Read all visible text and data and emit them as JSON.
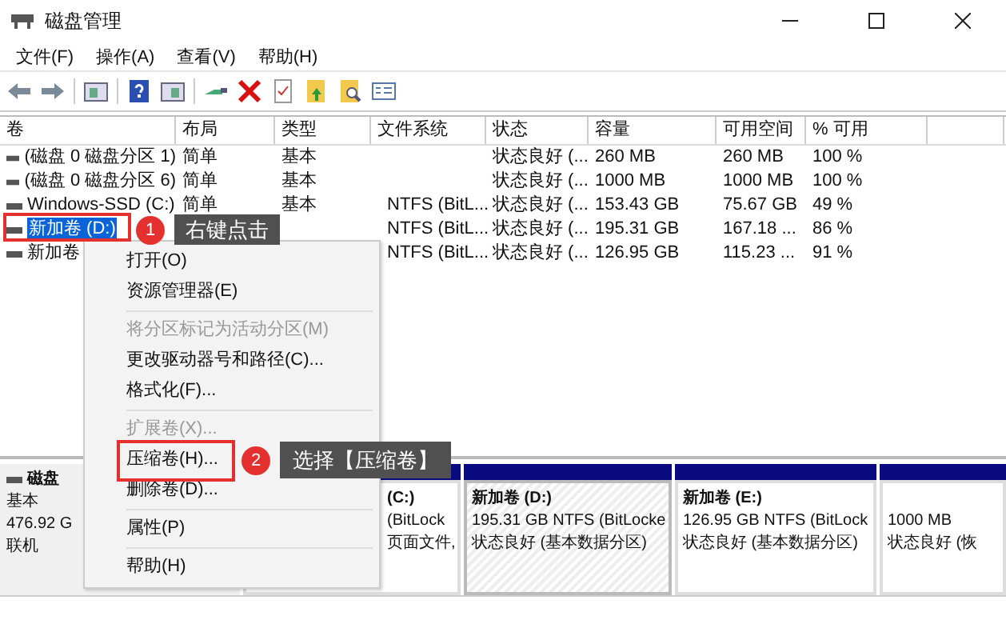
{
  "window": {
    "title": "磁盘管理"
  },
  "menu": [
    "文件(F)",
    "操作(A)",
    "查看(V)",
    "帮助(H)"
  ],
  "table": {
    "columns": [
      "卷",
      "布局",
      "类型",
      "文件系统",
      "状态",
      "容量",
      "可用空间",
      "% 可用"
    ],
    "rows": [
      {
        "cells": [
          "(磁盘 0 磁盘分区 1)",
          "简单",
          "基本",
          "",
          "状态良好 (...",
          "260 MB",
          "260 MB",
          "100 %"
        ],
        "selected": false
      },
      {
        "cells": [
          "(磁盘 0 磁盘分区 6)",
          "简单",
          "基本",
          "",
          "状态良好 (...",
          "1000 MB",
          "1000 MB",
          "100 %"
        ],
        "selected": false
      },
      {
        "cells": [
          "Windows-SSD (C:)",
          "简单",
          "基本",
          "NTFS (BitL...",
          "状态良好 (...",
          "153.43 GB",
          "75.67 GB",
          "49 %"
        ],
        "selected": false
      },
      {
        "cells": [
          "新加卷 (D:)",
          "",
          "",
          "NTFS (BitL...",
          "状态良好 (...",
          "195.31 GB",
          "167.18 ...",
          "86 %"
        ],
        "selected": true
      },
      {
        "cells": [
          "新加卷",
          "",
          "",
          "NTFS (BitL...",
          "状态良好 (...",
          "126.95 GB",
          "115.23 ...",
          "91 %"
        ],
        "selected": false
      }
    ]
  },
  "disk": {
    "lines": [
      "磁盘",
      "基本",
      "476.92 G",
      "联机"
    ],
    "partitions": [
      {
        "lines": [
          "(C:)",
          "(BitLock",
          "页面文件,"
        ],
        "selected": false
      },
      {
        "lines": [
          "新加卷 (D:)",
          "195.31 GB NTFS (BitLocke",
          "状态良好 (基本数据分区)"
        ],
        "selected": true
      },
      {
        "lines": [
          "新加卷 (E:)",
          "126.95 GB NTFS (BitLock",
          "状态良好 (基本数据分区)"
        ],
        "selected": false
      },
      {
        "lines": [
          "1000 MB",
          "状态良好 (恢"
        ],
        "selected": false
      }
    ]
  },
  "context_menu": [
    {
      "kind": "item",
      "label": "打开(O)",
      "disabled": false
    },
    {
      "kind": "item",
      "label": "资源管理器(E)",
      "disabled": false
    },
    {
      "kind": "separator"
    },
    {
      "kind": "item",
      "label": "将分区标记为活动分区(M)",
      "disabled": true
    },
    {
      "kind": "item",
      "label": "更改驱动器号和路径(C)...",
      "disabled": false
    },
    {
      "kind": "item",
      "label": "格式化(F)...",
      "disabled": false
    },
    {
      "kind": "separator"
    },
    {
      "kind": "item",
      "label": "扩展卷(X)...",
      "disabled": true
    },
    {
      "kind": "item",
      "label": "压缩卷(H)...",
      "disabled": false
    },
    {
      "kind": "item",
      "label": "删除卷(D)...",
      "disabled": false
    },
    {
      "kind": "separator"
    },
    {
      "kind": "item",
      "label": "属性(P)",
      "disabled": false
    },
    {
      "kind": "separator"
    },
    {
      "kind": "item",
      "label": "帮助(H)",
      "disabled": false
    }
  ],
  "annotations": [
    {
      "number": "1",
      "text": "右键点击"
    },
    {
      "number": "2",
      "text": "选择【压缩卷】"
    }
  ]
}
